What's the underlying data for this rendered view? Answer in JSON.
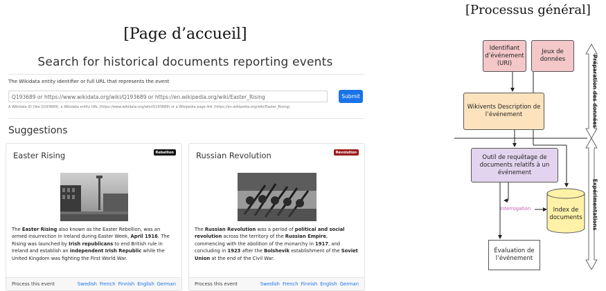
{
  "left": {
    "page_label": "[Page d’accueil]",
    "title": "Search for historical documents reporting events",
    "field_label": "The Wikidata entity identifier or full URL that represents the event",
    "input_placeholder": "Q193689 or https://www.wikidata.org/wiki/Q193689 or https://en.wikipedia.org/wiki/Easter_Rising",
    "submit_label": "Submit",
    "help_text": "A Wikidata ID (like Q193689), a Wikidata entity URL (https://www.wikidata.org/wiki/Q193689) or a Wikipedia page link (https://en.wikipedia.org/wiki/Easter_Rising).",
    "suggestions_heading": "Suggestions",
    "cards": [
      {
        "title": "Easter Rising",
        "badge": "Rebellion",
        "badge_color": "#111111",
        "body": [
          {
            "t": "The "
          },
          {
            "t": "Easter Rising",
            "b": true
          },
          {
            "t": " also known as the Easter Rebellion, was an armed insurrection in Ireland during Easter Week, "
          },
          {
            "t": "April 1916",
            "b": true
          },
          {
            "t": ". The Rising was launched by "
          },
          {
            "t": "Irish republicans",
            "b": true
          },
          {
            "t": " to end British rule in Ireland and establish an "
          },
          {
            "t": "independent Irish Republic",
            "b": true
          },
          {
            "t": " while the United Kingdom was fighting the First World War."
          }
        ],
        "footer_label": "Process this event",
        "languages": [
          "Swedish",
          "French",
          "Finnish",
          "English",
          "German"
        ]
      },
      {
        "title": "Russian Revolution",
        "badge": "Revolution",
        "badge_color": "#9b1c1c",
        "body": [
          {
            "t": "The "
          },
          {
            "t": "Russian Revolution",
            "b": true
          },
          {
            "t": " was a period of "
          },
          {
            "t": "political and social revolution",
            "b": true
          },
          {
            "t": " across the territory of the "
          },
          {
            "t": "Russian Empire",
            "b": true
          },
          {
            "t": ", commencing with the abolition of the monarchy in "
          },
          {
            "t": "1917",
            "b": true
          },
          {
            "t": ", and concluding in "
          },
          {
            "t": "1923",
            "b": true
          },
          {
            "t": " after the "
          },
          {
            "t": "Bolshevik",
            "b": true
          },
          {
            "t": " establishment of the "
          },
          {
            "t": "Soviet Union",
            "b": true
          },
          {
            "t": " at the end of the Civil War."
          }
        ],
        "footer_label": "Process this event",
        "languages": [
          "Swedish",
          "French",
          "Finnish",
          "English",
          "German"
        ]
      }
    ]
  },
  "right": {
    "process_label": "[Processus général]",
    "boxes": {
      "identifiant": "Identifiant d’événement (URI)",
      "jeux": "Jeux de données",
      "wikivents": "Wikivents Description de l’événement",
      "outil": "Outil de requêtage de documents relatifs à un événement",
      "index": "Index de documents",
      "evaluation": "Évaluation de l’événement",
      "interrogation": "Interrogation"
    },
    "side_top": "Préparation des données",
    "side_bottom": "Expérimentations",
    "colors": {
      "pink": "#f4c7c9",
      "orange": "#fde3bd",
      "purple": "#e2d4ee",
      "yellow": "#fff2a8",
      "interrogation": "#c45ab3"
    }
  }
}
